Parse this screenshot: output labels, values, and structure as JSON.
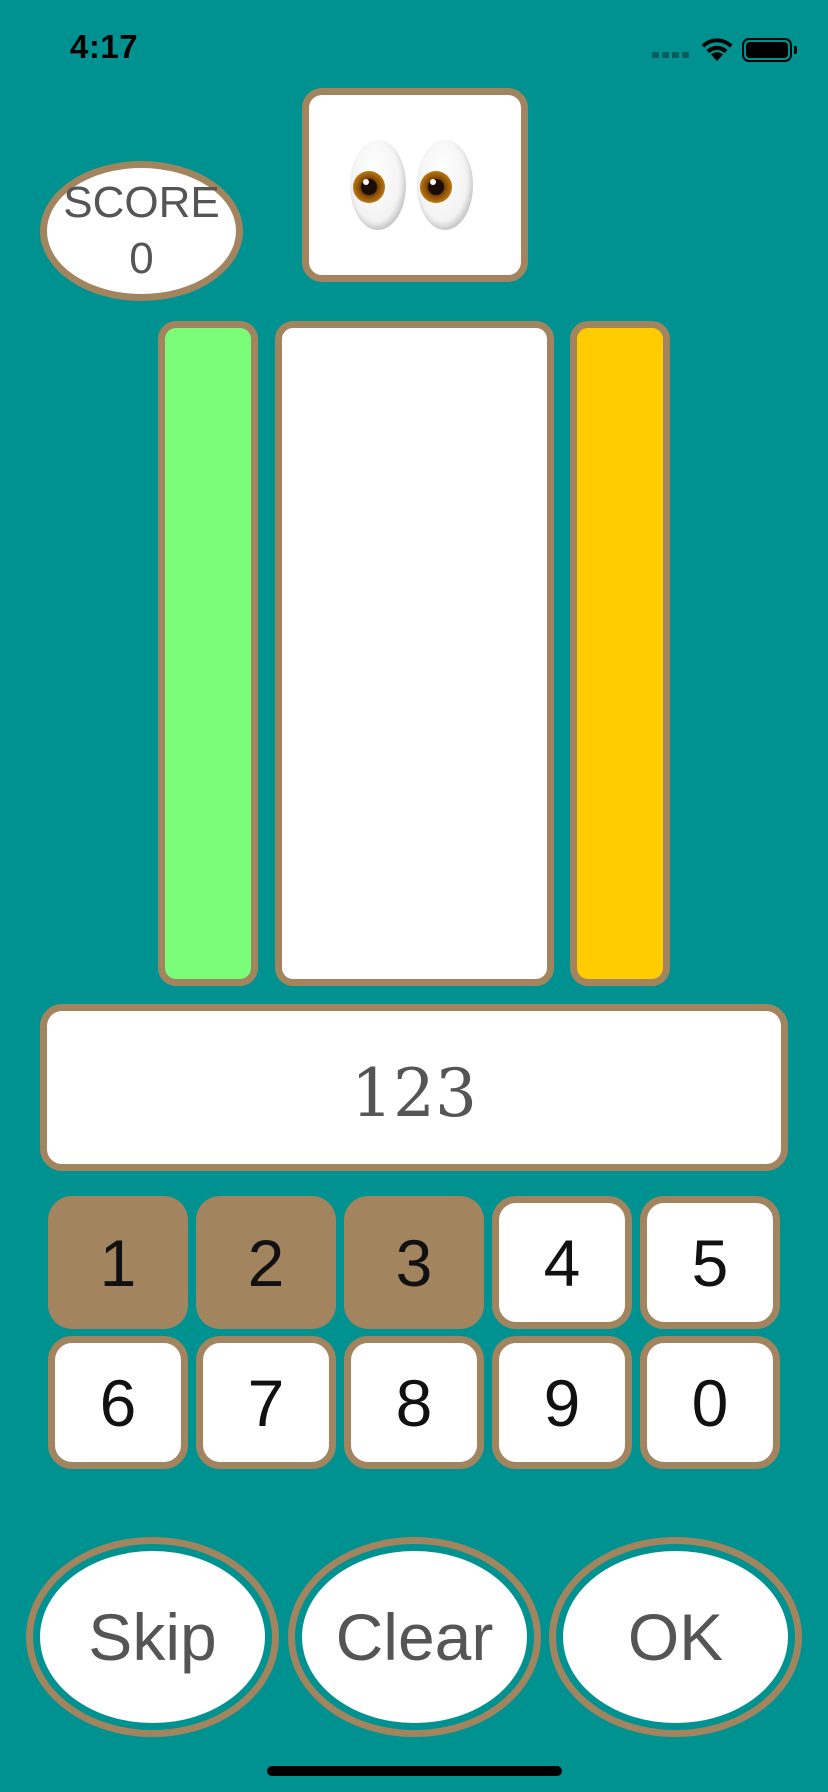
{
  "status_bar": {
    "time": "4:17",
    "icons": [
      "cellular-signal-icon",
      "wifi-icon",
      "battery-icon"
    ]
  },
  "score": {
    "label": "SCORE",
    "value": "0"
  },
  "hint": {
    "emoji": "eyes-emoji"
  },
  "bars": {
    "left_color": "#7AFC78",
    "center_color": "#FFFFFF",
    "right_color": "#FFCC00"
  },
  "answer": {
    "value": "123"
  },
  "keypad": {
    "keys": [
      {
        "label": "1",
        "state": "used"
      },
      {
        "label": "2",
        "state": "used"
      },
      {
        "label": "3",
        "state": "used"
      },
      {
        "label": "4",
        "state": "unused"
      },
      {
        "label": "5",
        "state": "unused"
      },
      {
        "label": "6",
        "state": "unused"
      },
      {
        "label": "7",
        "state": "unused"
      },
      {
        "label": "8",
        "state": "unused"
      },
      {
        "label": "9",
        "state": "unused"
      },
      {
        "label": "0",
        "state": "unused"
      }
    ]
  },
  "actions": {
    "skip": "Skip",
    "clear": "Clear",
    "ok": "OK"
  },
  "colors": {
    "background": "#009191",
    "border": "#A2845E",
    "used_key": "#A2845E",
    "text": "#555555"
  }
}
